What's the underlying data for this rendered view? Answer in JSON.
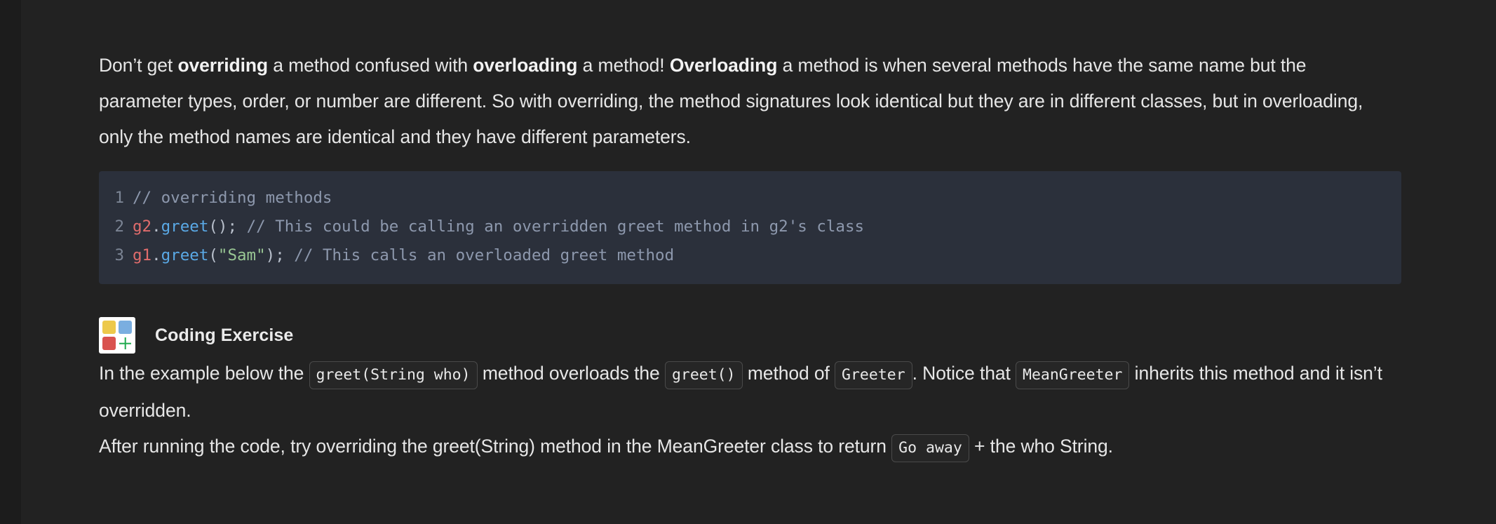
{
  "theme": {
    "page_background": "#222222",
    "text_color": "#e6e6e6",
    "code_block_background": "#2b303b",
    "inline_code_background": "#262626",
    "inline_code_border": "#4a4a4a",
    "icon_yellow": "#edc94b",
    "icon_blue": "#7aaee0",
    "icon_red": "#d9534f",
    "icon_green": "#1faa4e",
    "code_comment": "#8d98ad",
    "code_variable": "#e06c6c",
    "code_function": "#5aa9e6",
    "code_string": "#99c794",
    "code_punctuation": "#b9c0cc",
    "code_linenumber": "#7b8494"
  },
  "paragraph_1": {
    "s1": "Don’t get ",
    "b1": "overriding",
    "s2": " a method confused with ",
    "b2": "overloading",
    "s3": " a method! ",
    "b3": "Overloading",
    "s4": " a method is when several methods have the same name but the parameter types, order, or number are different. So with overriding, the method signatures look identical but they are in different classes, but in overloading, only the method names are identical and they have different parameters."
  },
  "code_block": {
    "lines": [
      {
        "number": "1",
        "tokens": [
          {
            "text": "// overriding methods",
            "type": "comment"
          }
        ]
      },
      {
        "number": "2",
        "tokens": [
          {
            "text": "g2",
            "type": "var"
          },
          {
            "text": ".",
            "type": "punc"
          },
          {
            "text": "greet",
            "type": "fn"
          },
          {
            "text": "(); ",
            "type": "punc"
          },
          {
            "text": "// This could be calling an overridden greet method in g2's class",
            "type": "comment"
          }
        ]
      },
      {
        "number": "3",
        "tokens": [
          {
            "text": "g1",
            "type": "var"
          },
          {
            "text": ".",
            "type": "punc"
          },
          {
            "text": "greet",
            "type": "fn"
          },
          {
            "text": "(",
            "type": "punc"
          },
          {
            "text": "\"Sam\"",
            "type": "str"
          },
          {
            "text": "); ",
            "type": "punc"
          },
          {
            "text": "// This calls an overloaded greet method",
            "type": "comment"
          }
        ]
      }
    ]
  },
  "exercise": {
    "icon_name": "coding-exercise-icon",
    "title": "Coding Exercise"
  },
  "paragraph_2": {
    "t1": "In the example below the ",
    "code1": "greet(String who)",
    "t2": " method overloads the ",
    "code2": "greet()",
    "t3": " method of ",
    "code3": "Greeter",
    "t4": ". Notice that ",
    "code4": "MeanGreeter",
    "t5": " inherits this method and it isn’t overridden."
  },
  "paragraph_3": {
    "t1": "After running the code, try overriding the greet(String) method in the MeanGreeter class to return ",
    "code1": "Go away",
    "t2": " + the who String."
  }
}
